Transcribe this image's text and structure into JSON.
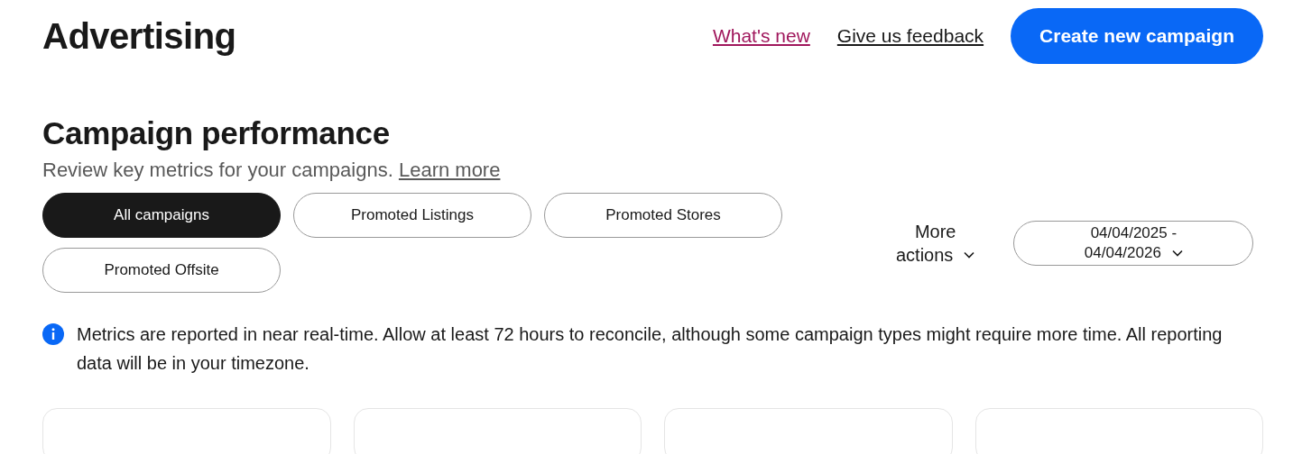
{
  "header": {
    "title": "Advertising",
    "links": [
      {
        "label": "What's new",
        "kind": "accent"
      },
      {
        "label": "Give us feedback",
        "kind": "plain"
      }
    ],
    "primary_button": "Create new campaign"
  },
  "section": {
    "title": "Campaign performance",
    "subtitle": "Review key metrics for your campaigns.",
    "subtitle_link": "Learn more"
  },
  "filters": [
    {
      "label": "All campaigns",
      "selected": true
    },
    {
      "label": "Promoted Listings",
      "selected": false
    },
    {
      "label": "Promoted Stores",
      "selected": false
    },
    {
      "label": "Promoted Offsite",
      "selected": false
    }
  ],
  "more_actions": {
    "label_line_1": "More",
    "label_line_2": "actions"
  },
  "date_range": {
    "start": "04/04/2025 -",
    "end": "04/04/2026"
  },
  "notice": "Metrics are reported in near real-time. Allow at least 72 hours to reconcile, although some campaign types might require more time. All reporting data will be in your timezone.",
  "metric_cards": [
    {
      "kind": "card"
    },
    {
      "kind": "card"
    },
    {
      "kind": "card"
    },
    {
      "kind": "card"
    }
  ]
}
